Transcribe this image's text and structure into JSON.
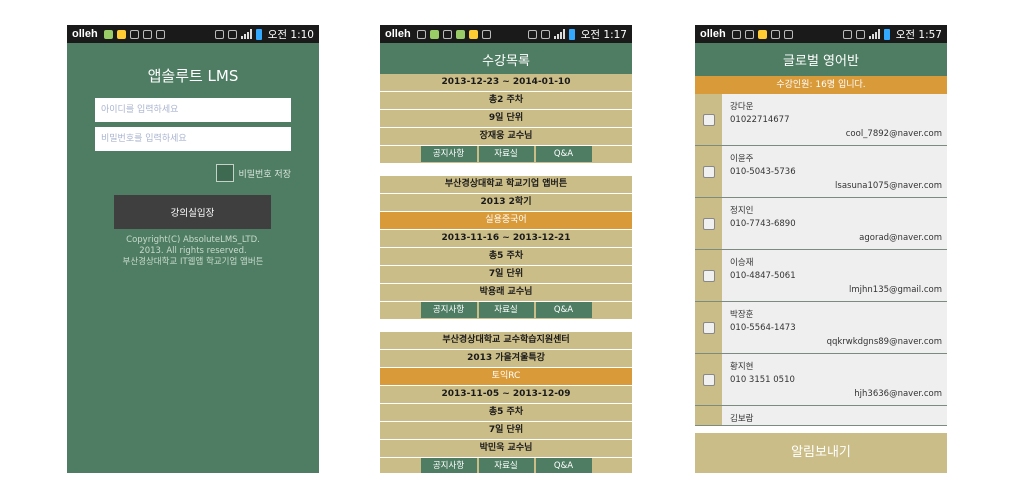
{
  "screen1": {
    "status": {
      "carrier": "olleh",
      "time": "오전 1:10"
    },
    "title": "앱솔루트 LMS",
    "id_placeholder": "아이디를 입력하세요",
    "pw_placeholder": "비밀번호를 입력하세요",
    "save_password_label": "비밀번호 저장",
    "enter_button": "강의실입장",
    "copyright": [
      "Copyright(C) AbsoluteLMS_LTD.",
      "2013. All rights reserved.",
      "부산경상대학교 IT웹앱 학교기업 앱버튼"
    ]
  },
  "screen2": {
    "status": {
      "carrier": "olleh",
      "time": "오전 1:17"
    },
    "title": "수강목록",
    "buttons": {
      "notice": "공지사항",
      "resources": "자료실",
      "qa": "Q&A"
    },
    "courses": [
      {
        "period": "2013-12-23 ~ 2014-01-10",
        "weeks": "총2 주차",
        "units": "9일 단위",
        "professor": "장재웅 교수님"
      },
      {
        "institution": "부산경상대학교 학교기업 앱버튼",
        "term": "2013 2학기",
        "name": "실용중국어",
        "period": "2013-11-16 ~ 2013-12-21",
        "weeks": "총5 주차",
        "units": "7일 단위",
        "professor": "박용래 교수님"
      },
      {
        "institution": "부산경상대학교 교수학습지원센터",
        "term": "2013 가을겨울특강",
        "name": "토익RC",
        "period": "2013-11-05 ~ 2013-12-09",
        "weeks": "총5 주차",
        "units": "7일 단위",
        "professor": "박민욱 교수님"
      }
    ]
  },
  "screen3": {
    "status": {
      "carrier": "olleh",
      "time": "오전 1:57"
    },
    "title": "글로벌 영어반",
    "count_text": "수강인원: 16명 입니다.",
    "members": [
      {
        "name": "강다운",
        "phone": "01022714677",
        "email": "cool_7892@naver.com"
      },
      {
        "name": "이윤주",
        "phone": "010-5043-5736",
        "email": "lsasuna1075@naver.com"
      },
      {
        "name": "정지인",
        "phone": "010-7743-6890",
        "email": "agorad@naver.com"
      },
      {
        "name": "이승재",
        "phone": "010-4847-5061",
        "email": "lmjhn135@gmail.com"
      },
      {
        "name": "박장훈",
        "phone": "010-5564-1473",
        "email": "qqkrwkdgns89@naver.com"
      },
      {
        "name": "황지현",
        "phone": "010 3151 0510",
        "email": "hjh3636@naver.com"
      },
      {
        "name": "김보람"
      }
    ],
    "send_button": "알림보내기"
  }
}
